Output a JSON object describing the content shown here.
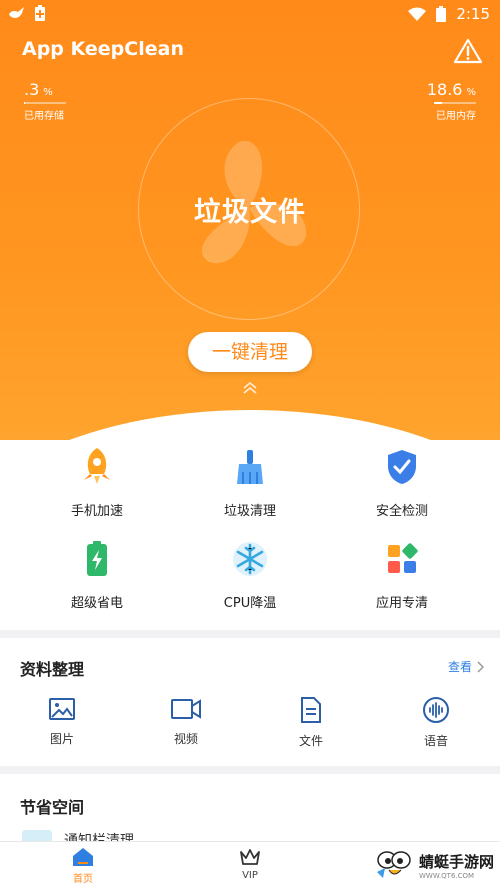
{
  "status_bar": {
    "time": "2:15",
    "icons": [
      "bird-icon",
      "battery-saver-icon",
      "wifi-icon",
      "battery-icon"
    ]
  },
  "header": {
    "app_title": "App KeepClean",
    "warning_icon": "warning-icon"
  },
  "storage": {
    "value": ".3",
    "unit": "%",
    "label": "已用存储",
    "percent": 0.3
  },
  "memory": {
    "value": "18.6",
    "unit": "%",
    "label": "已用内存",
    "percent": 18.6
  },
  "hero": {
    "title": "垃圾文件",
    "button_label": "一键清理"
  },
  "tools": [
    {
      "label": "手机加速",
      "icon": "rocket-icon"
    },
    {
      "label": "垃圾清理",
      "icon": "broom-icon"
    },
    {
      "label": "安全检测",
      "icon": "shield-check-icon"
    },
    {
      "label": "超级省电",
      "icon": "battery-bolt-icon"
    },
    {
      "label": "CPU降温",
      "icon": "snowflake-icon"
    },
    {
      "label": "应用专清",
      "icon": "apps-icon"
    }
  ],
  "files_section": {
    "title": "资料整理",
    "view_label": "查看",
    "items": [
      {
        "label": "图片",
        "icon": "image-icon"
      },
      {
        "label": "视频",
        "icon": "video-icon"
      },
      {
        "label": "文件",
        "icon": "file-icon"
      },
      {
        "label": "语音",
        "icon": "voice-icon"
      }
    ]
  },
  "save_section": {
    "title": "节省空间",
    "partial_item": "通知栏清理"
  },
  "tabbar": [
    {
      "label": "首页",
      "icon": "home-icon",
      "active": true
    },
    {
      "label": "VIP",
      "icon": "crown-icon",
      "active": false
    }
  ],
  "watermark": {
    "text": "蜻蜓手游网",
    "sub": "WWW.QT6.COM"
  },
  "colors": {
    "accent": "#ff8a1a",
    "link": "#2f7fe0"
  }
}
